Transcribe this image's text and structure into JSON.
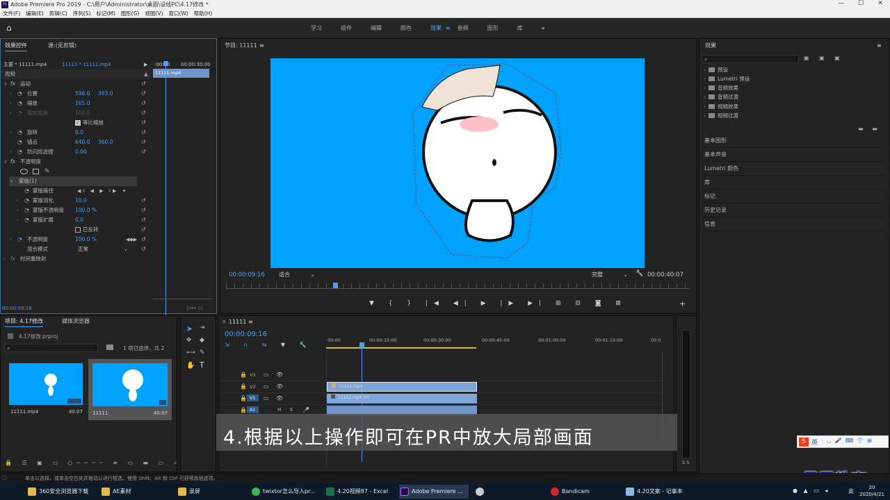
{
  "titlebar": {
    "app": "Pr",
    "title": "Adobe Premiere Pro 2019 - C:\\用户\\Administrator\\桌面\\设线PC\\4.17修改 *",
    "min": "—",
    "max": "☐",
    "close": "✕"
  },
  "menu": [
    "文件(F)",
    "编辑(E)",
    "剪辑(C)",
    "序列(S)",
    "标记(M)",
    "图形(G)",
    "视图(V)",
    "窗口(W)",
    "帮助(H)"
  ],
  "workspace": {
    "tabs": [
      "学习",
      "组件",
      "编辑",
      "颜色",
      "效果",
      "音频",
      "图形",
      "库"
    ],
    "active": "效果",
    "more": "»"
  },
  "effect_controls": {
    "tab1": "效果控件",
    "tab2": "源:(无剪辑)",
    "master": "主要 * 11111.mp4",
    "seq": "11111 * 11111.mp4",
    "time_start": ":00:00",
    "time_end": "00:00:30:00",
    "clip_label": "11111.mp4",
    "section_video": "视频",
    "motion": "运动",
    "position_label": "位置",
    "position_x": "596.0",
    "position_y": "393.0",
    "scale_label": "缩放",
    "scale_val": "165.0",
    "scale_width_label": "缩放宽度",
    "scale_width_val": "100.0",
    "uniform_label": "等比缩放",
    "rotation_label": "旋转",
    "rotation_val": "0.0",
    "anchor_label": "锚点",
    "anchor_x": "640.0",
    "anchor_y": "360.0",
    "flicker_label": "防闪烁滤镜",
    "flicker_val": "0.00",
    "opacity_section": "不透明度",
    "mask_label": "蒙版(1)",
    "mask_path_label": "蒙版路径",
    "mask_feather_label": "蒙版羽化",
    "mask_feather_val": "10.0",
    "mask_opacity_label": "蒙版不透明度",
    "mask_opacity_val": "100.0 %",
    "mask_expand_label": "蒙版扩展",
    "mask_expand_val": "0.0",
    "inverted_label": "已反转",
    "opacity_label": "不透明度",
    "opacity_val": "100.0 %",
    "blend_label": "混合模式",
    "blend_val": "正常",
    "time_remap": "时间重映射",
    "current_time": "00:00:09:16"
  },
  "program": {
    "title": "节目: 11111",
    "time": "00:00:09:16",
    "fit": "适合",
    "quality": "完整",
    "duration": "00:00:40:07"
  },
  "effects_panel": {
    "title": "效果",
    "items": [
      "预设",
      "Lumetri 预设",
      "音频效果",
      "音频过渡",
      "视频效果",
      "视频过渡"
    ],
    "panels": [
      "基本图形",
      "基本声音",
      "Lumetri 颜色",
      "库",
      "标记",
      "历史记录",
      "信息"
    ]
  },
  "project": {
    "tab1": "项目: 4.17修改",
    "tab2": "媒体浏览器",
    "file": "4.17修改.prproj",
    "selection": "1 项已选择，共 2",
    "items": [
      {
        "name": "11111.mp4",
        "dur": "40:07"
      },
      {
        "name": "11111",
        "dur": "40:07"
      }
    ]
  },
  "timeline": {
    "title": "11111",
    "time": "00:00:09:16",
    "ruler": [
      ":00:00",
      "00:00:15:00",
      "00:00:30:00",
      "00:00:45:00",
      "00:01:00:00",
      "00:01:15:00",
      "00:0"
    ],
    "tracks": [
      "V3",
      "V2",
      "V1",
      "A1"
    ],
    "clip_v2": "11111.mp4",
    "clip_v1": "11111.mp4 [V]",
    "audio_meter": "S S"
  },
  "caption": "4.根据以上操作即可在PR中放大局部画面",
  "watermark": "最需教育",
  "statusbar": "单击以选择，或单击空白处并拖动以进行框选。使用 Shift、Alt 和 Ctrl 可获得其他选项。",
  "taskbar": {
    "items": [
      "360安全浏览器下载",
      "AE素材",
      "录屏",
      "twixtor怎么导入pr...",
      "4.20视频87 - Excel",
      "Adobe Premiere ...",
      "",
      "Bandicam",
      "4.20文案 - 记事本"
    ],
    "time": "20",
    "date": "2020/4/21",
    "ime": "英"
  },
  "colors": {
    "accent": "#4a9eff",
    "canvas": "#00a2ff",
    "clip": "#7fa4d8"
  }
}
